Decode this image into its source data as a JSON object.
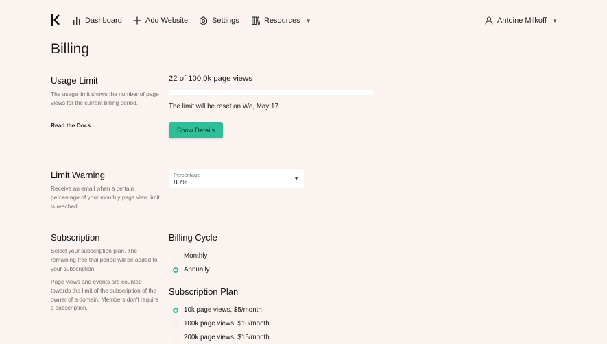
{
  "nav": {
    "dashboard": "Dashboard",
    "add_website": "Add Website",
    "settings": "Settings",
    "resources": "Resources",
    "user": "Antoine Milkoff"
  },
  "page": {
    "title": "Billing"
  },
  "usage": {
    "title": "Usage Limit",
    "description": "The usage limit shows the number of page views for the current billing period.",
    "docs_link": "Read the Docs",
    "summary": "22 of 100.0k page views",
    "used": 22,
    "limit": 100000,
    "reset_text": "The limit will be reset on We, May 17.",
    "button": "Show Details"
  },
  "warning": {
    "title": "Limit Warning",
    "description": "Receive an email when a certain percentage of your monthly page view limit is reached.",
    "select_label": "Percentage",
    "select_value": "80%"
  },
  "subscription": {
    "title": "Subscription",
    "description_1": "Select your subscription plan. The remaining free trial period will be added to your subscription.",
    "description_2": "Page views and events are counted towards the limit of the subscription of the owner of a domain. Members don't require a subscription.",
    "billing_cycle_title": "Billing Cycle",
    "billing_cycle_options": [
      {
        "label": "Monthly",
        "selected": false
      },
      {
        "label": "Annually",
        "selected": true
      }
    ],
    "plan_title": "Subscription Plan",
    "plan_options": [
      {
        "label": "10k page views, $5/month",
        "selected": true
      },
      {
        "label": "100k page views, $10/month",
        "selected": false
      },
      {
        "label": "200k page views, $15/month",
        "selected": false
      }
    ]
  },
  "colors": {
    "accent": "#2dbd97",
    "background": "#faf3ef"
  }
}
